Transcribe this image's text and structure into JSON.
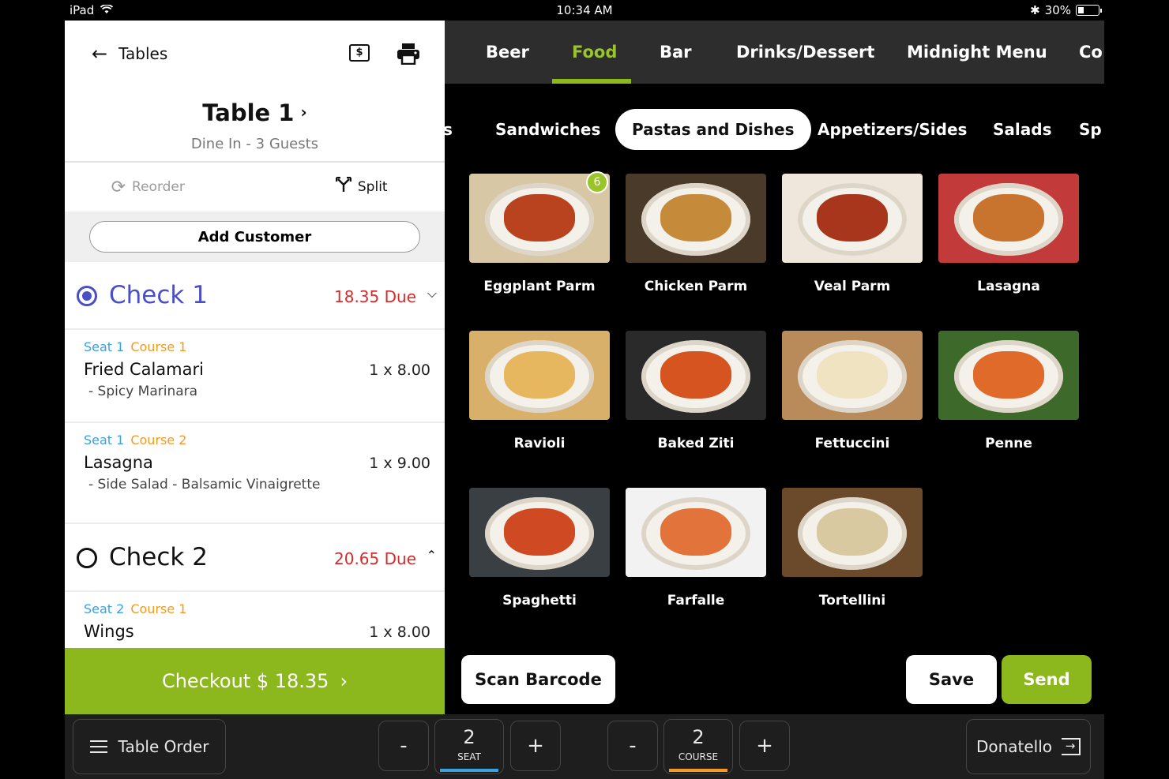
{
  "status_bar": {
    "device": "iPad",
    "time": "10:34 AM",
    "battery": "30%",
    "battery_level": 0.3
  },
  "header": {
    "back_label": "Tables",
    "table_title": "Table 1",
    "subtitle": "Dine In - 3 Guests"
  },
  "actions": {
    "reorder": "Reorder",
    "split": "Split",
    "add_customer": "Add Customer"
  },
  "checks": [
    {
      "name": "Check 1",
      "due": "18.35 Due",
      "selected": true,
      "expanded": true,
      "items": [
        {
          "seat": "Seat 1",
          "course": "Course 1",
          "name": "Fried Calamari",
          "qty": "1 x 8.00",
          "mods": "- Spicy Marinara"
        },
        {
          "seat": "Seat 1",
          "course": "Course 2",
          "name": "Lasagna",
          "qty": "1 x 9.00",
          "mods": "- Side Salad - Balsamic Vinaigrette"
        }
      ]
    },
    {
      "name": "Check 2",
      "due": "20.65 Due",
      "selected": false,
      "expanded": true,
      "items": [
        {
          "seat": "Seat 2",
          "course": "Course 1",
          "name": "Wings",
          "qty": "1 x 8.00",
          "mods": ""
        }
      ]
    }
  ],
  "checkout_label": "Checkout $ 18.35",
  "top_tabs": [
    "Beer",
    "Food",
    "Bar",
    "Drinks/Dessert",
    "Midnight Menu",
    "Co"
  ],
  "active_tab": "Food",
  "sub_categories": [
    "s",
    "Sandwiches",
    "Pastas and Dishes",
    "Appetizers/Sides",
    "Salads",
    "Sp"
  ],
  "active_sub": "Pastas and Dishes",
  "menu_items": [
    {
      "name": "Eggplant Parm",
      "badge": "6",
      "icon": "eggplant-parm-photo",
      "bg": "#d8c7a4",
      "food": "#b9421f"
    },
    {
      "name": "Chicken Parm",
      "badge": "",
      "icon": "chicken-parm-photo",
      "bg": "#4a3a2a",
      "food": "#c58a3a"
    },
    {
      "name": "Veal Parm",
      "badge": "",
      "icon": "veal-parm-photo",
      "bg": "#efe7dc",
      "food": "#a8361d"
    },
    {
      "name": "Lasagna",
      "badge": "",
      "icon": "lasagna-photo",
      "bg": "#c33a3a",
      "food": "#c9742e"
    },
    {
      "name": "Ravioli",
      "badge": "",
      "icon": "ravioli-photo",
      "bg": "#d9b06a",
      "food": "#e7b760"
    },
    {
      "name": "Baked Ziti",
      "badge": "",
      "icon": "baked-ziti-photo",
      "bg": "#2a2a2a",
      "food": "#d5541f"
    },
    {
      "name": "Fettuccini",
      "badge": "",
      "icon": "fettuccini-photo",
      "bg": "#b98a5a",
      "food": "#efe3c2"
    },
    {
      "name": "Penne",
      "badge": "",
      "icon": "penne-photo",
      "bg": "#3d6a2a",
      "food": "#e06a2a"
    },
    {
      "name": "Spaghetti",
      "badge": "",
      "icon": "spaghetti-photo",
      "bg": "#3a3f44",
      "food": "#cf4a22"
    },
    {
      "name": "Farfalle",
      "badge": "",
      "icon": "farfalle-photo",
      "bg": "#f2f2f2",
      "food": "#e2733a"
    },
    {
      "name": "Tortellini",
      "badge": "",
      "icon": "tortellini-photo",
      "bg": "#6a4a2a",
      "food": "#d9c9a0"
    }
  ],
  "buttons": {
    "scan": "Scan Barcode",
    "save": "Save",
    "send": "Send"
  },
  "bottom": {
    "table_order": "Table Order",
    "seat": {
      "minus": "-",
      "value": "2",
      "label": "SEAT",
      "plus": "+"
    },
    "course": {
      "minus": "-",
      "value": "2",
      "label": "COURSE",
      "plus": "+"
    },
    "user": "Donatello"
  },
  "colors": {
    "accent_green": "#8cb81e",
    "check_blue": "#4a4fc7",
    "due_red": "#d52b2b",
    "seat_blue": "#3aa0e0",
    "course_orange": "#f39a22"
  }
}
